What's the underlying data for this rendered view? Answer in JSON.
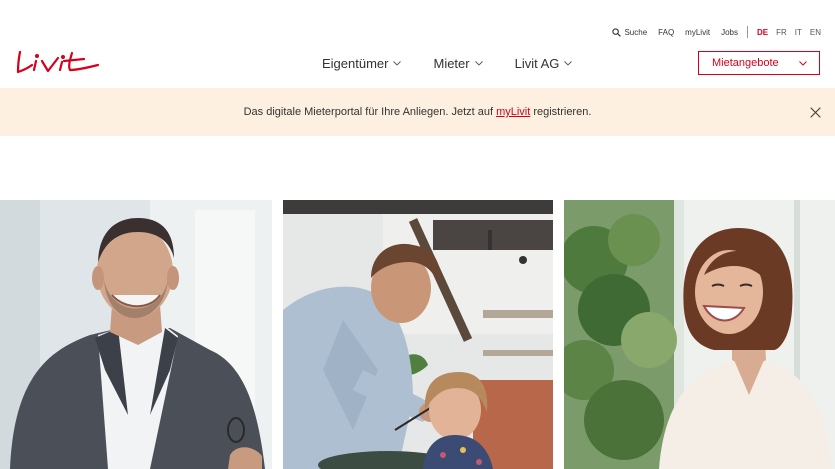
{
  "brand": {
    "logo_text": "Livit",
    "accent_color": "#d6001c"
  },
  "utility_nav": {
    "search_label": "Suche",
    "faq_label": "FAQ",
    "mylivit_label": "myLivit",
    "jobs_label": "Jobs",
    "languages": [
      "DE",
      "FR",
      "IT",
      "EN"
    ],
    "active_language": "DE"
  },
  "main_nav": {
    "items": [
      {
        "label": "Eigentümer"
      },
      {
        "label": "Mieter"
      },
      {
        "label": "Livit AG"
      }
    ]
  },
  "cta": {
    "label": "Mietangebote"
  },
  "banner": {
    "text_before": "Das digitale Mieterportal für Ihre Anliegen. Jetzt auf",
    "link_label": "myLivit",
    "text_after": "registrieren.",
    "background": "#fdf0e0"
  },
  "teasers": [
    {
      "icon": "photo-man-portrait"
    },
    {
      "icon": "photo-father-daughter-kitchen"
    },
    {
      "icon": "photo-woman-laughing"
    }
  ]
}
